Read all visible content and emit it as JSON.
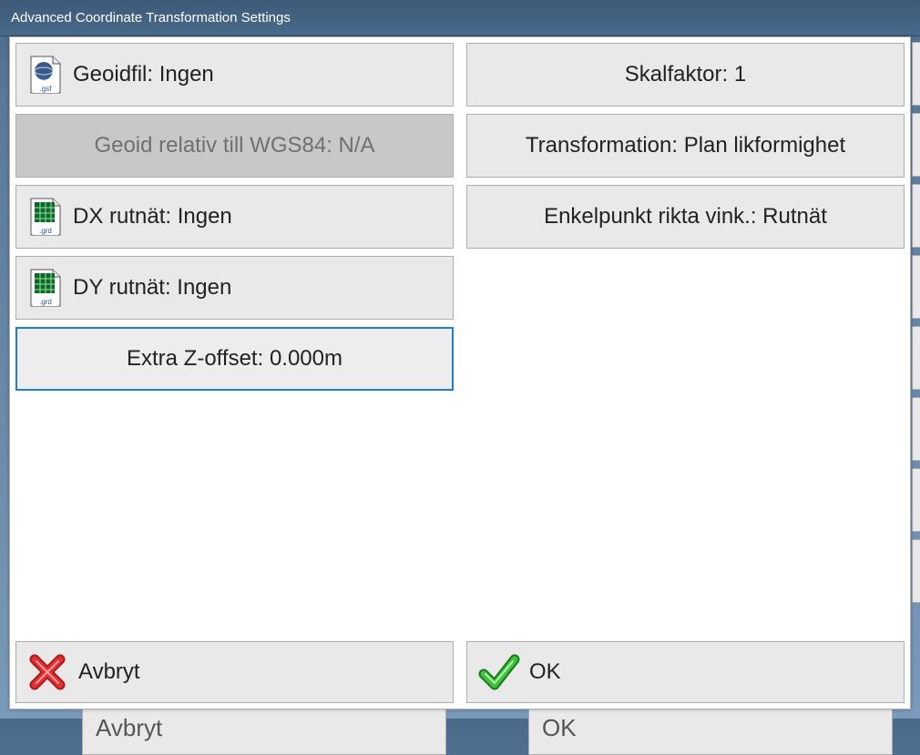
{
  "title": "Advanced Coordinate Transformation Settings",
  "left": {
    "geoid_file": "Geoidfil: Ingen",
    "geoid_relative": "Geoid relativ till WGS84: N/A",
    "dx_grid": "DX rutnät: Ingen",
    "dy_grid": "DY rutnät: Ingen",
    "z_offset": "Extra Z-offset: 0.000m"
  },
  "right": {
    "scale_factor": "Skalfaktor: 1",
    "transformation": "Transformation: Plan likformighet",
    "single_point": "Enkelpunkt rikta vink.: Rutnät"
  },
  "footer": {
    "cancel": "Avbryt",
    "ok": "OK"
  },
  "behind": {
    "cancel": "Avbryt",
    "ok": "OK"
  }
}
